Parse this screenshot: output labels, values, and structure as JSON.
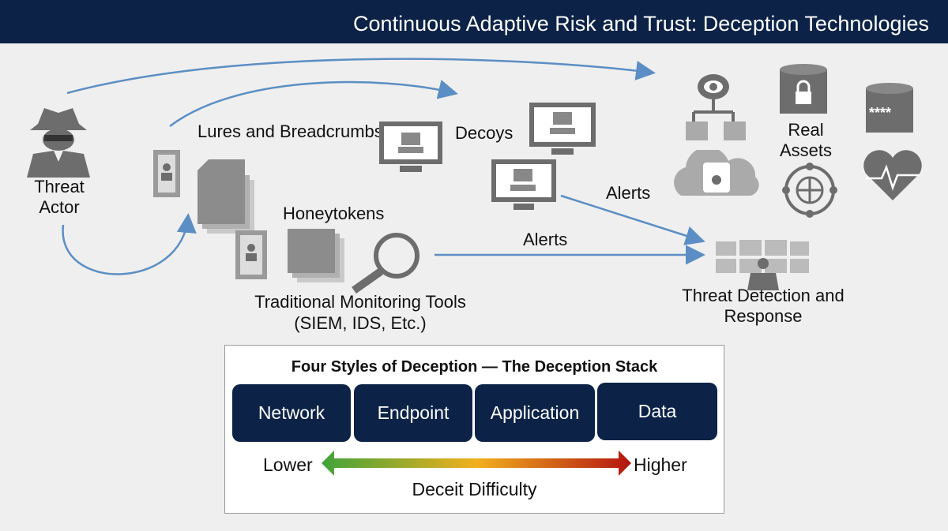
{
  "title": "Continuous Adaptive Risk and Trust: Deception Technologies",
  "labels": {
    "threat_actor": "Threat Actor",
    "lures": "Lures and Breadcrumbs",
    "honeytokens": "Honeytokens",
    "decoys": "Decoys",
    "alerts_1": "Alerts",
    "alerts_2": "Alerts",
    "real_assets": "Real Assets",
    "monitoring": "Traditional Monitoring Tools",
    "monitoring_sub": "(SIEM, IDS, Etc.)",
    "detection": "Threat Detection and Response"
  },
  "stack": {
    "title": "Four Styles of Deception — The Deception Stack",
    "styles": [
      "Network",
      "Endpoint",
      "Application",
      "Data"
    ],
    "low": "Lower",
    "high": "Higher",
    "scale_label": "Deceit Difficulty",
    "password_mask": "****"
  },
  "colors": {
    "navy": "#0c2347",
    "arrow": "#5b8ec4",
    "icon": "#6d6d6d",
    "low": "#3fa33a",
    "mid": "#f2b01e",
    "high": "#b3140f"
  }
}
